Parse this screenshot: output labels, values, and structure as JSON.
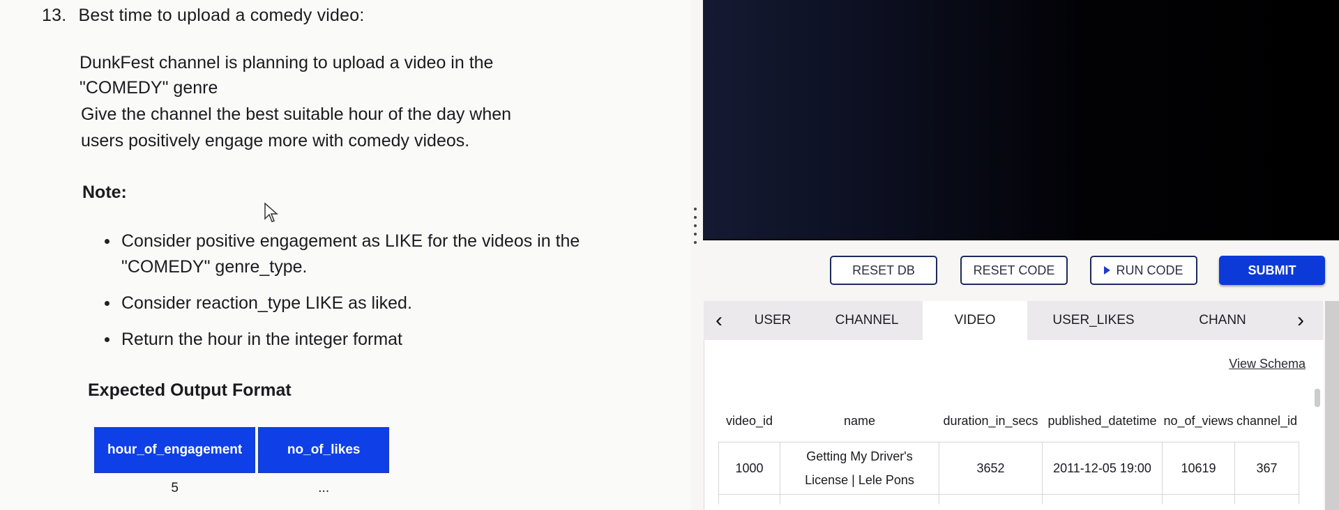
{
  "question": {
    "number": "13.",
    "title": "Best time to upload a comedy video:",
    "description_lines": [
      "DunkFest channel is planning to upload a video in the",
      "\"COMEDY\" genre",
      "Give the channel the best suitable hour of the day when",
      "users positively engage more with comedy videos."
    ],
    "note_heading": "Note:",
    "notes": [
      "Consider positive engagement as LIKE for the videos in the \"COMEDY\" genre_type.",
      "Consider reaction_type LIKE as liked.",
      "Return the hour in the integer format"
    ],
    "expected_output": {
      "heading": "Expected Output Format",
      "columns": [
        "hour_of_engagement",
        "no_of_likes"
      ],
      "rows": [
        [
          "5",
          "..."
        ]
      ]
    }
  },
  "toolbar": {
    "reset_db": "RESET DB",
    "reset_code": "RESET CODE",
    "run_code": "RUN CODE",
    "submit": "SUBMIT"
  },
  "db_tabs": {
    "prev_icon": "chevron-left-icon",
    "next_icon": "chevron-right-icon",
    "items": [
      "USER",
      "CHANNEL",
      "VIDEO",
      "USER_LIKES",
      "CHANN"
    ],
    "active": "VIDEO"
  },
  "db_view": {
    "view_schema": "View Schema",
    "columns": [
      "video_id",
      "name",
      "duration_in_secs",
      "published_datetime",
      "no_of_views",
      "channel_id"
    ],
    "rows": [
      [
        "1000",
        "Getting My Driver's License | Lele Pons",
        "3652",
        "2011-12-05 19:00",
        "10619",
        "367"
      ]
    ]
  },
  "colors": {
    "accent": "#0b3ad9",
    "table_header": "#0f3fe6",
    "editor_bg": "#000000"
  }
}
